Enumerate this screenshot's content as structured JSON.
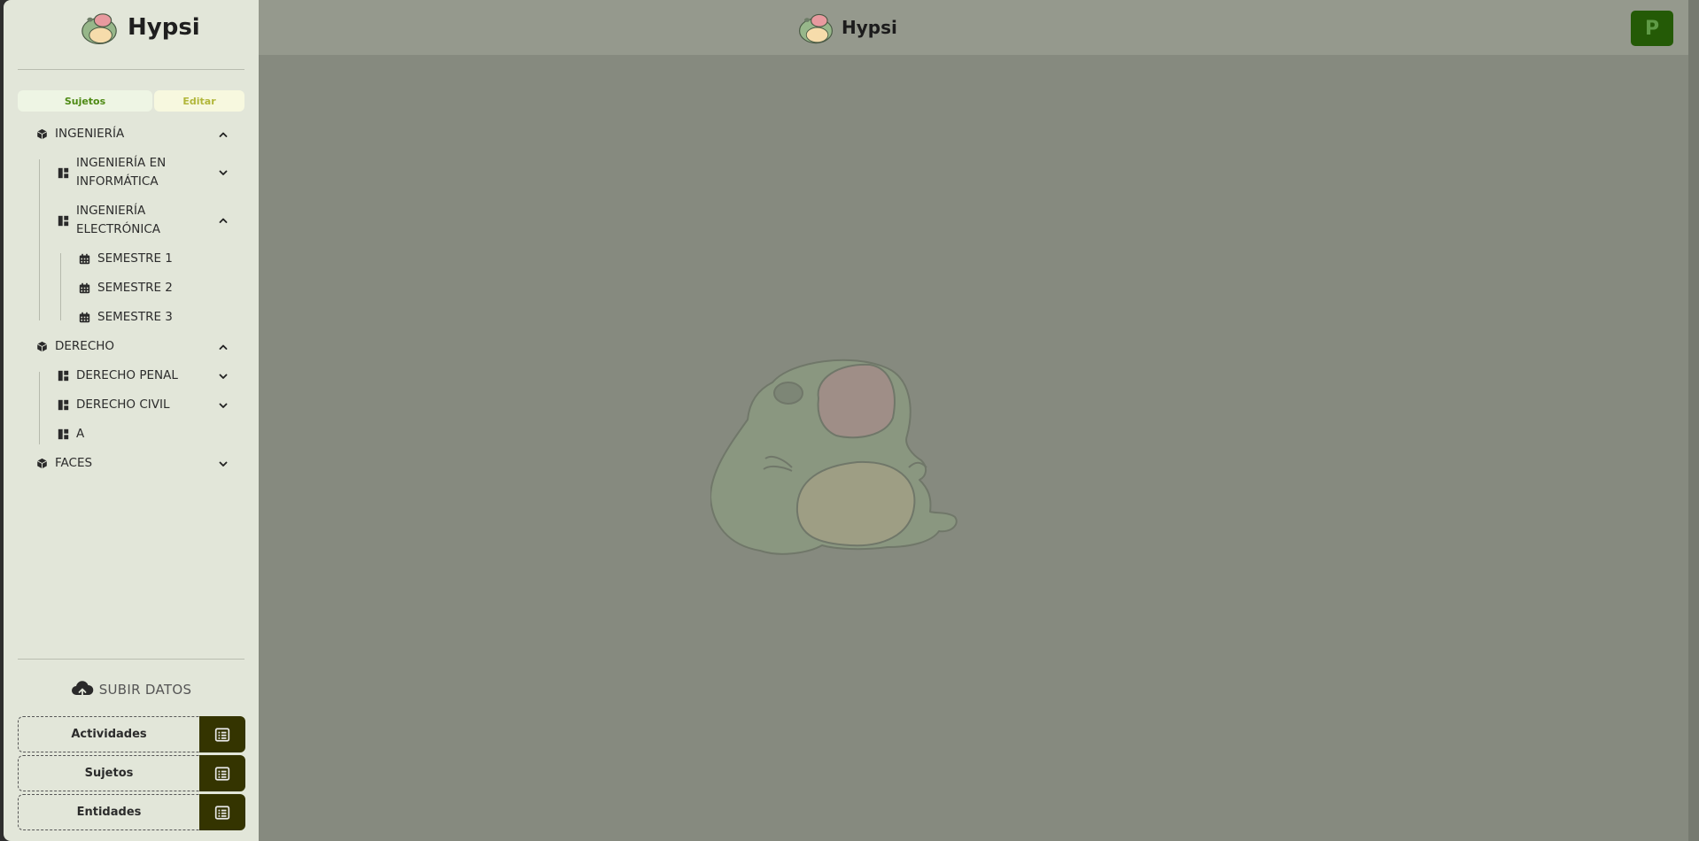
{
  "app": {
    "name": "Hypsi"
  },
  "sidebar": {
    "tabs": {
      "subjects": "Sujetos",
      "edit": "Editar"
    },
    "tree": {
      "ingenieria": {
        "label": "INGENIERÍA"
      },
      "ing_informatica": {
        "label_l1": "INGENIERÍA EN",
        "label_l2": "INFORMÁTICA"
      },
      "ing_electronica": {
        "label_l1": "INGENIERÍA",
        "label_l2": "ELECTRÓNICA"
      },
      "sem1": {
        "label": "SEMESTRE 1"
      },
      "sem2": {
        "label": "SEMESTRE 2"
      },
      "sem3": {
        "label": "SEMESTRE 3"
      },
      "derecho": {
        "label": "DERECHO"
      },
      "derecho_penal": {
        "label": "DERECHO PENAL"
      },
      "derecho_civil": {
        "label": "DERECHO CIVIL"
      },
      "a": {
        "label": "A"
      },
      "faces": {
        "label": "FACES"
      }
    },
    "upload": {
      "label": "SUBIR DATOS"
    },
    "downloads": {
      "activities": "Actividades",
      "subjects": "Sujetos",
      "entities": "Entidades"
    }
  },
  "header": {
    "avatar_initial": "P"
  },
  "colors": {
    "sidebar_bg": "#e2e6d9",
    "main_bg": "#868a7f",
    "accent_dark": "#343400",
    "avatar_bg": "#245a06"
  },
  "icons": {
    "faculty": "cube-icon",
    "career": "dashboard-icon",
    "semester": "calendar-icon",
    "expanded": "chevron-up-icon",
    "collapsed": "chevron-down-icon",
    "upload": "cloud-upload-icon",
    "list": "list-icon"
  }
}
